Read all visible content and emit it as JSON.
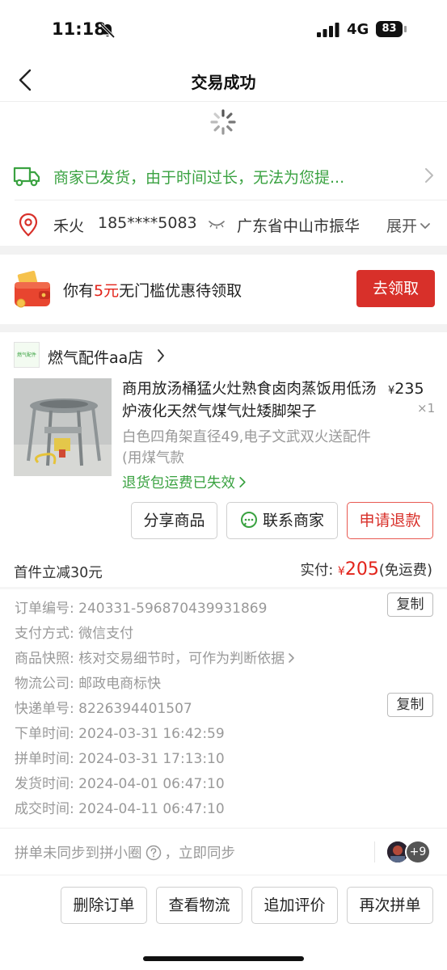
{
  "status_bar": {
    "time": "11:18",
    "network": "4G",
    "battery": "83"
  },
  "nav": {
    "title": "交易成功"
  },
  "shipping": {
    "text": "商家已发货，由于时间过长，无法为您提..."
  },
  "address": {
    "name": "禾火",
    "phone": "185****5083",
    "address": "广东省中山市振华",
    "expand": "展开"
  },
  "coupon": {
    "prefix": "你有",
    "amount": "5元",
    "suffix": "无门槛优惠待领取",
    "button": "去领取"
  },
  "shop": {
    "logo_text": "燃气配件",
    "name": "燃气配件aa店"
  },
  "product": {
    "title": "商用放汤桶猛火灶熟食卤肉蒸饭用低汤炉液化天然气煤气灶矮脚架子",
    "currency": "¥",
    "price": "235",
    "quantity": "×1",
    "spec": "白色四角架直径49,电子文武双火送配件(用煤气款",
    "return_note": "退货包运费已失效"
  },
  "actions": {
    "share": "分享商品",
    "contact": "联系商家",
    "refund": "申请退款"
  },
  "summary": {
    "discount": "首件立减30元",
    "paid_label": "实付:",
    "paid_currency": "¥",
    "paid_amount": "205",
    "paid_note": "(免运费)"
  },
  "order_info": [
    {
      "label": "订单编号:",
      "value": "240331-596870439931869"
    },
    {
      "label": "支付方式:",
      "value": "微信支付"
    },
    {
      "label": "商品快照:",
      "value": "核对交易细节时，可作为判断依据"
    },
    {
      "label": "物流公司:",
      "value": "邮政电商标快"
    },
    {
      "label": "快递单号:",
      "value": "8226394401507"
    },
    {
      "label": "下单时间:",
      "value": "2024-03-31 16:42:59"
    },
    {
      "label": "拼单时间:",
      "value": "2024-03-31 17:13:10"
    },
    {
      "label": "发货时间:",
      "value": "2024-04-01 06:47:10"
    },
    {
      "label": "成交时间:",
      "value": "2024-04-11 06:47:10"
    }
  ],
  "copy_label": "复制",
  "sync": {
    "text_a": "拼单未同步到拼小圈",
    "text_b": "，立即同步",
    "avatar_more": "+9"
  },
  "bottom_actions": {
    "delete": "删除订单",
    "logistics": "查看物流",
    "review": "追加评价",
    "reorder": "再次拼单"
  },
  "colors": {
    "green": "#3aa241",
    "red": "#e2231a",
    "button_red": "#d8302a"
  }
}
